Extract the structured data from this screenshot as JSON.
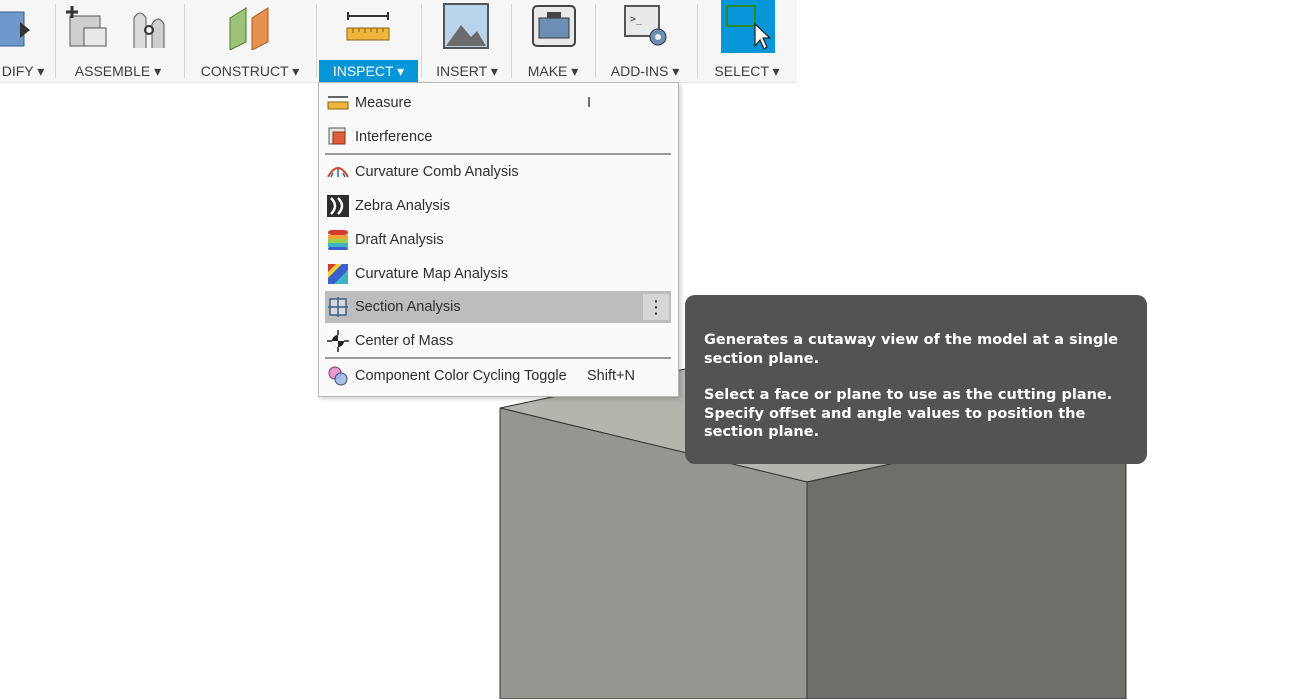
{
  "toolbar": {
    "groups": [
      {
        "label": "DIFY ▾"
      },
      {
        "label": "ASSEMBLE ▾"
      },
      {
        "label": "CONSTRUCT ▾"
      },
      {
        "label": "INSPECT ▾"
      },
      {
        "label": "INSERT ▾"
      },
      {
        "label": "MAKE ▾"
      },
      {
        "label": "ADD-INS ▾"
      },
      {
        "label": "SELECT ▾"
      }
    ]
  },
  "inspect_menu": {
    "items": [
      {
        "label": "Measure",
        "shortcut": "I",
        "icon": "ruler-icon"
      },
      {
        "label": "Interference",
        "shortcut": "",
        "icon": "interference-icon"
      },
      {
        "label": "Curvature Comb Analysis",
        "shortcut": "",
        "icon": "curvature-comb-icon"
      },
      {
        "label": "Zebra Analysis",
        "shortcut": "",
        "icon": "zebra-icon"
      },
      {
        "label": "Draft Analysis",
        "shortcut": "",
        "icon": "draft-analysis-icon"
      },
      {
        "label": "Curvature Map Analysis",
        "shortcut": "",
        "icon": "curvature-map-icon"
      },
      {
        "label": "Section Analysis",
        "shortcut": "",
        "icon": "section-analysis-icon",
        "more": "⋮"
      },
      {
        "label": "Center of Mass",
        "shortcut": "",
        "icon": "center-of-mass-icon"
      },
      {
        "label": "Component Color Cycling Toggle",
        "shortcut": "Shift+N",
        "icon": "color-cycling-icon"
      }
    ]
  },
  "tooltip": {
    "line1": "Generates a cutaway view of the model at a single section plane.",
    "line2": "Select a face or plane to use as the cutting plane. Specify offset and angle values to position the section plane."
  },
  "colors": {
    "accent": "#0696d7",
    "menu_hover": "#bdbdbd",
    "tooltip_bg": "#535353",
    "model_left": "#969690",
    "model_right": "#6e6e6a"
  }
}
